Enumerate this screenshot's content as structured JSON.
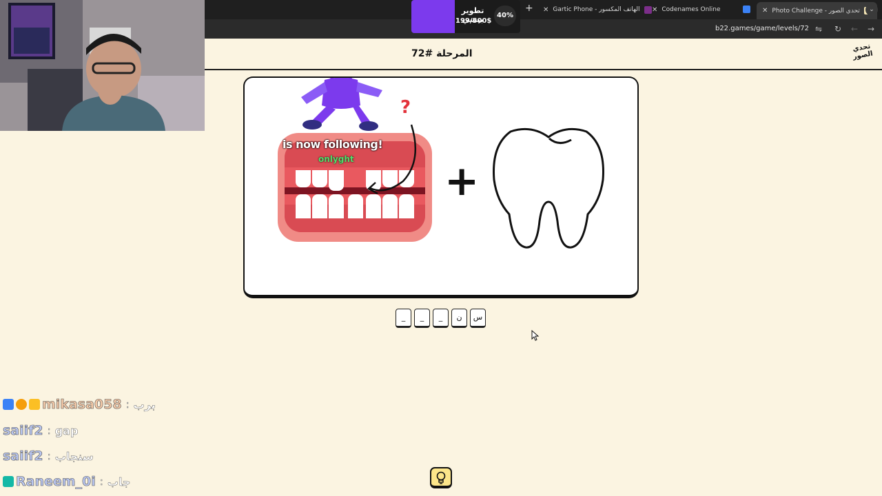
{
  "browser": {
    "tabs": [
      {
        "label": "Gartic Phone - الهاتف المكسور",
        "active": false
      },
      {
        "label": "Codenames Online",
        "active": false
      },
      {
        "label": "Photo Challenge - تحدي الصور",
        "active": true
      }
    ],
    "url": "b22.games/game/levels/72"
  },
  "goal_widget": {
    "title": "تطوير بيسي",
    "amount": "199/500$",
    "percent_label": "40%",
    "progress": 0.4,
    "color": "#7c3aed"
  },
  "page": {
    "level_title": "المرحلة #72",
    "logo_text": "تحدي الصور"
  },
  "puzzle": {
    "question_mark": "?",
    "plus": "+"
  },
  "overlay": {
    "follow_message": "is now following!",
    "follow_user": "onlyght"
  },
  "answer": {
    "slots": [
      "س",
      "ن",
      "_",
      "_",
      "_"
    ]
  },
  "chat": [
    {
      "user": "mikasa058",
      "message": "برب"
    },
    {
      "user": "saiif2",
      "message": "gap"
    },
    {
      "user": "saiif2",
      "message": "سنجاب"
    },
    {
      "user": "Raneem_0i",
      "message": "جاب"
    }
  ],
  "icons": {
    "hint": "lightbulb-icon",
    "cursor": "mouse-pointer-icon"
  }
}
